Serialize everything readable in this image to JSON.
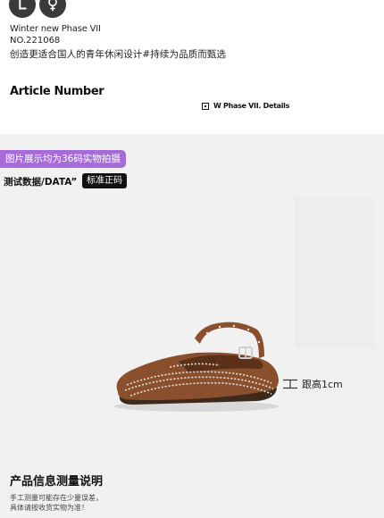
{
  "header": {
    "gender_icons": [
      {
        "name": "male-symbol-icon",
        "glyph": "male"
      },
      {
        "name": "female-symbol-icon",
        "glyph": "female"
      }
    ],
    "phase_title": "Winter new Phase VII",
    "product_number": "NO.221068",
    "slogan": "创造更适合国人的青年休闲设计#持续为品质而甄选"
  },
  "article": {
    "title": "Article Number",
    "details_label": "W Phase VII. Details"
  },
  "photo_section": {
    "note": "图片展示均为36码实物拍摄",
    "data_label": "测试数据/DATA”",
    "size_badge": "标准正码",
    "heel_label": "跟高1cm",
    "product_image": "brown-suede-studded-mary-jane-flat"
  },
  "info": {
    "title": "产品信息测量说明",
    "line1": "手工测量可能存在少量误差，",
    "line2": "具体请按收货实物为准！"
  },
  "colors": {
    "accent_purple": "#a66bd9",
    "badge_black": "#111111",
    "photo_bg": "#f1f1f1",
    "shoe_brown": "#8a4f2c"
  }
}
